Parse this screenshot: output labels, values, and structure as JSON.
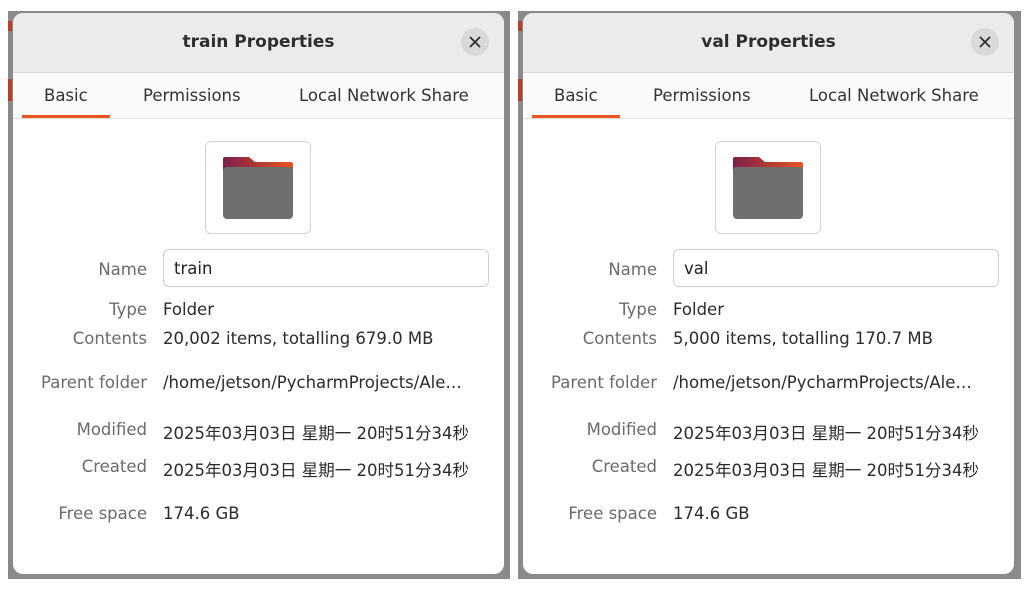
{
  "dialogs": [
    {
      "title": "train Properties",
      "tabs": [
        "Basic",
        "Permissions",
        "Local Network Share"
      ],
      "active_tab": "Basic",
      "fields": {
        "name_label": "Name",
        "name_value": "train",
        "type_label": "Type",
        "type_value": "Folder",
        "contents_label": "Contents",
        "contents_value": "20,002 items, totalling 679.0 MB",
        "parent_label": "Parent folder",
        "parent_value": "/home/jetson/PycharmProjects/Ale…",
        "modified_label": "Modified",
        "modified_value": "2025年03月03日 星期一 20时51分34秒",
        "created_label": "Created",
        "created_value": "2025年03月03日 星期一 20时51分34秒",
        "free_label": "Free space",
        "free_value": "174.6 GB"
      }
    },
    {
      "title": "val Properties",
      "tabs": [
        "Basic",
        "Permissions",
        "Local Network Share"
      ],
      "active_tab": "Basic",
      "fields": {
        "name_label": "Name",
        "name_value": "val",
        "type_label": "Type",
        "type_value": "Folder",
        "contents_label": "Contents",
        "contents_value": "5,000 items, totalling 170.7 MB",
        "parent_label": "Parent folder",
        "parent_value": "/home/jetson/PycharmProjects/Ale…",
        "modified_label": "Modified",
        "modified_value": "2025年03月03日 星期一 20时51分34秒",
        "created_label": "Created",
        "created_value": "2025年03月03日 星期一 20时51分34秒",
        "free_label": "Free space",
        "free_value": "174.6 GB"
      }
    }
  ],
  "icons": {
    "close": "close-icon",
    "folder": "folder-icon"
  },
  "colors": {
    "accent": "#e95420",
    "folder_body": "#6f6f6f",
    "folder_tab_start": "#7a1f4a",
    "folder_tab_end": "#e95420"
  }
}
